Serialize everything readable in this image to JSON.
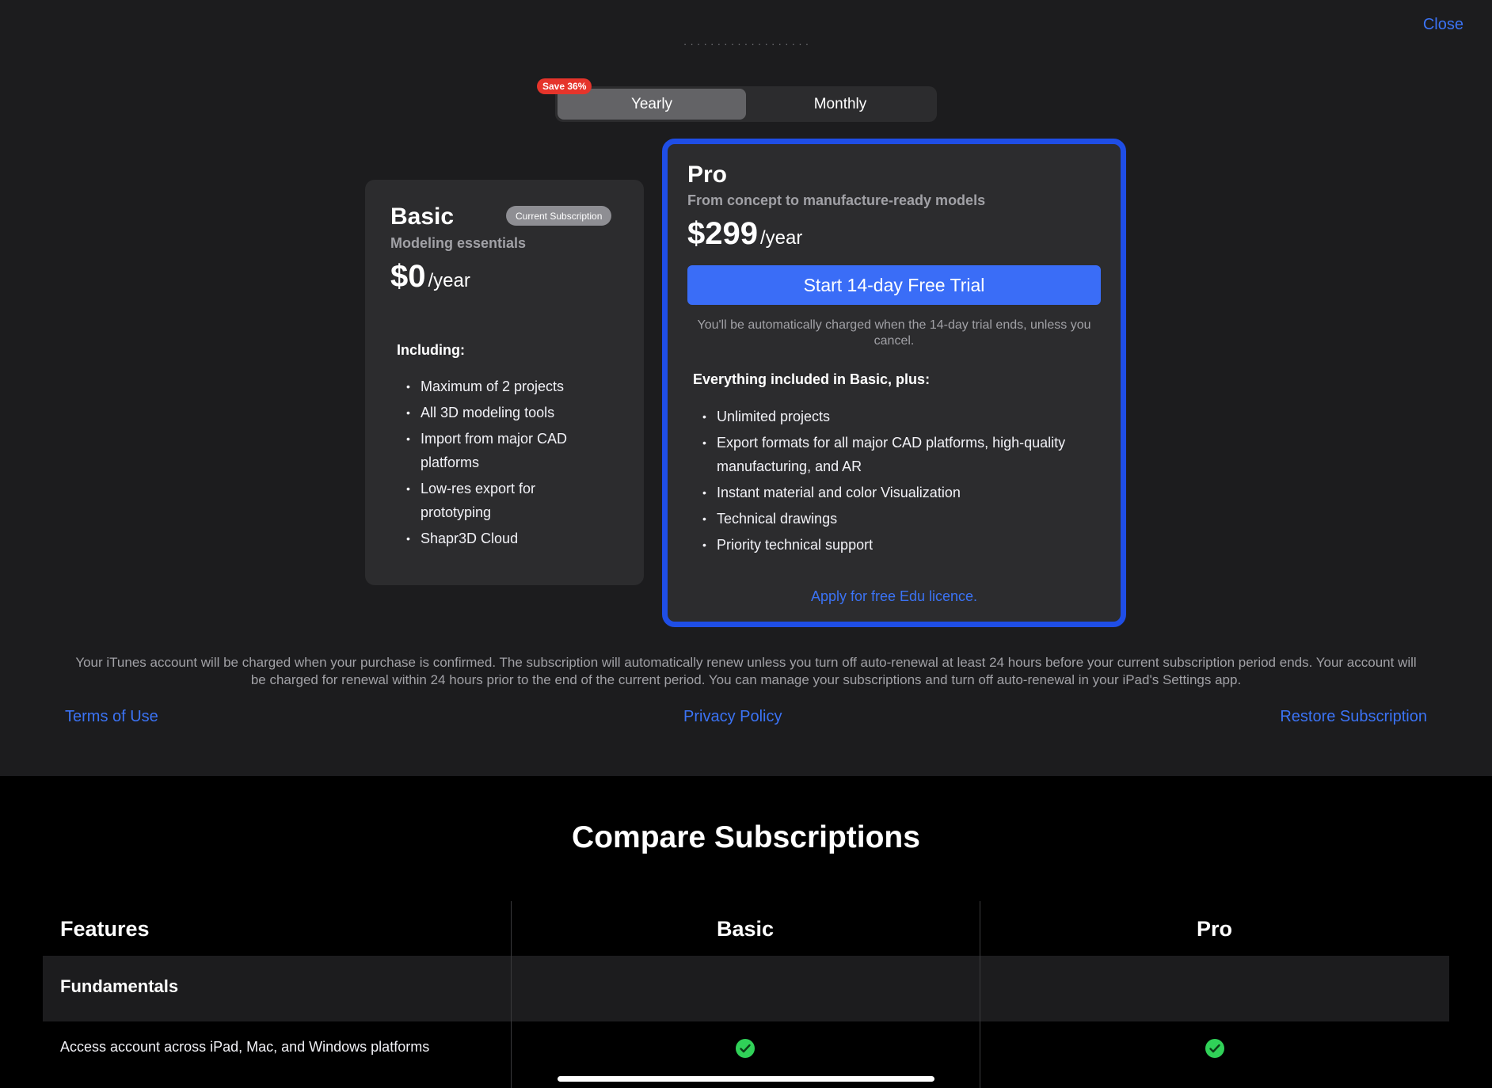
{
  "header": {
    "close_label": "Close",
    "faded_text": "· · · · · · · · · · · · · · · · · · ·"
  },
  "billing_toggle": {
    "save_badge": "Save 36%",
    "options": [
      "Yearly",
      "Monthly"
    ],
    "selected": "Yearly"
  },
  "basic_plan": {
    "name": "Basic",
    "badge": "Current Subscription",
    "tagline": "Modeling essentials",
    "price": "$0",
    "period": "/year",
    "including_label": "Including:",
    "features": [
      "Maximum of 2 projects",
      "All 3D modeling tools",
      "Import from major CAD platforms",
      "Low-res export for prototyping",
      "Shapr3D Cloud"
    ]
  },
  "pro_plan": {
    "name": "Pro",
    "tagline": "From concept to manufacture-ready models",
    "price": "$299",
    "period": "/year",
    "trial_button": "Start 14-day Free Trial",
    "trial_note": "You'll be automatically charged when the 14-day trial ends, unless you cancel.",
    "included_label": "Everything included in Basic, plus:",
    "features": [
      "Unlimited projects",
      "Export formats for all major CAD platforms, high-quality manufacturing, and AR",
      "Instant material and color Visualization",
      "Technical drawings",
      "Priority technical support"
    ],
    "edu_link": "Apply for free Edu licence.",
    "accent_color": "#1f4ee6"
  },
  "legal_text": "Your iTunes account will be charged when your purchase is confirmed. The subscription will automatically renew unless you turn off auto-renewal at least 24 hours before your current subscription period ends. Your account will be charged for renewal within 24 hours prior to the end of the current period. You can manage your subscriptions and turn off auto-renewal in your iPad's Settings app.",
  "footer_links": {
    "terms": "Terms of Use",
    "privacy": "Privacy Policy",
    "restore": "Restore Subscription"
  },
  "compare": {
    "title": "Compare Subscriptions",
    "columns": [
      "Features",
      "Basic",
      "Pro"
    ],
    "groups": [
      {
        "name": "Fundamentals",
        "rows": [
          {
            "feature": "Access account across iPad, Mac, and Windows platforms",
            "basic": "check-icon",
            "pro": "check-icon"
          }
        ]
      }
    ],
    "check_color": "#30d158"
  }
}
